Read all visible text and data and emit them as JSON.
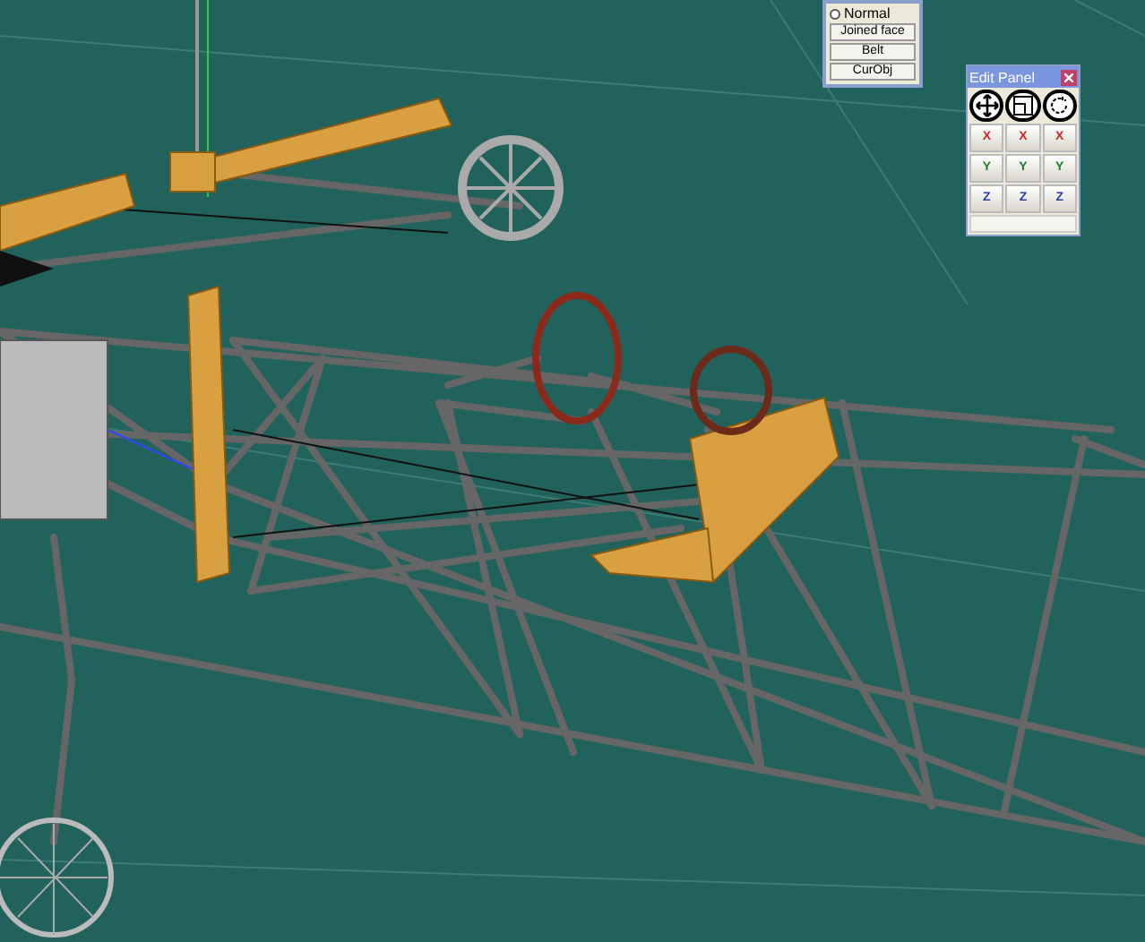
{
  "top_panel": {
    "option": {
      "label": "Normal",
      "selected": false
    },
    "buttons": [
      "Joined face",
      "Belt",
      "CurObj"
    ]
  },
  "edit_panel": {
    "title": "Edit Panel",
    "tools": [
      {
        "kind": "move"
      },
      {
        "kind": "scale"
      },
      {
        "kind": "rotate"
      }
    ],
    "axis_rows": [
      {
        "buttons": [
          "X",
          "X",
          "X"
        ],
        "color": "#d02828"
      },
      {
        "buttons": [
          "Y",
          "Y",
          "Y"
        ],
        "color": "#1f7a2a"
      },
      {
        "buttons": [
          "Z",
          "Z",
          "Z"
        ],
        "color": "#2a3fa0"
      }
    ]
  }
}
